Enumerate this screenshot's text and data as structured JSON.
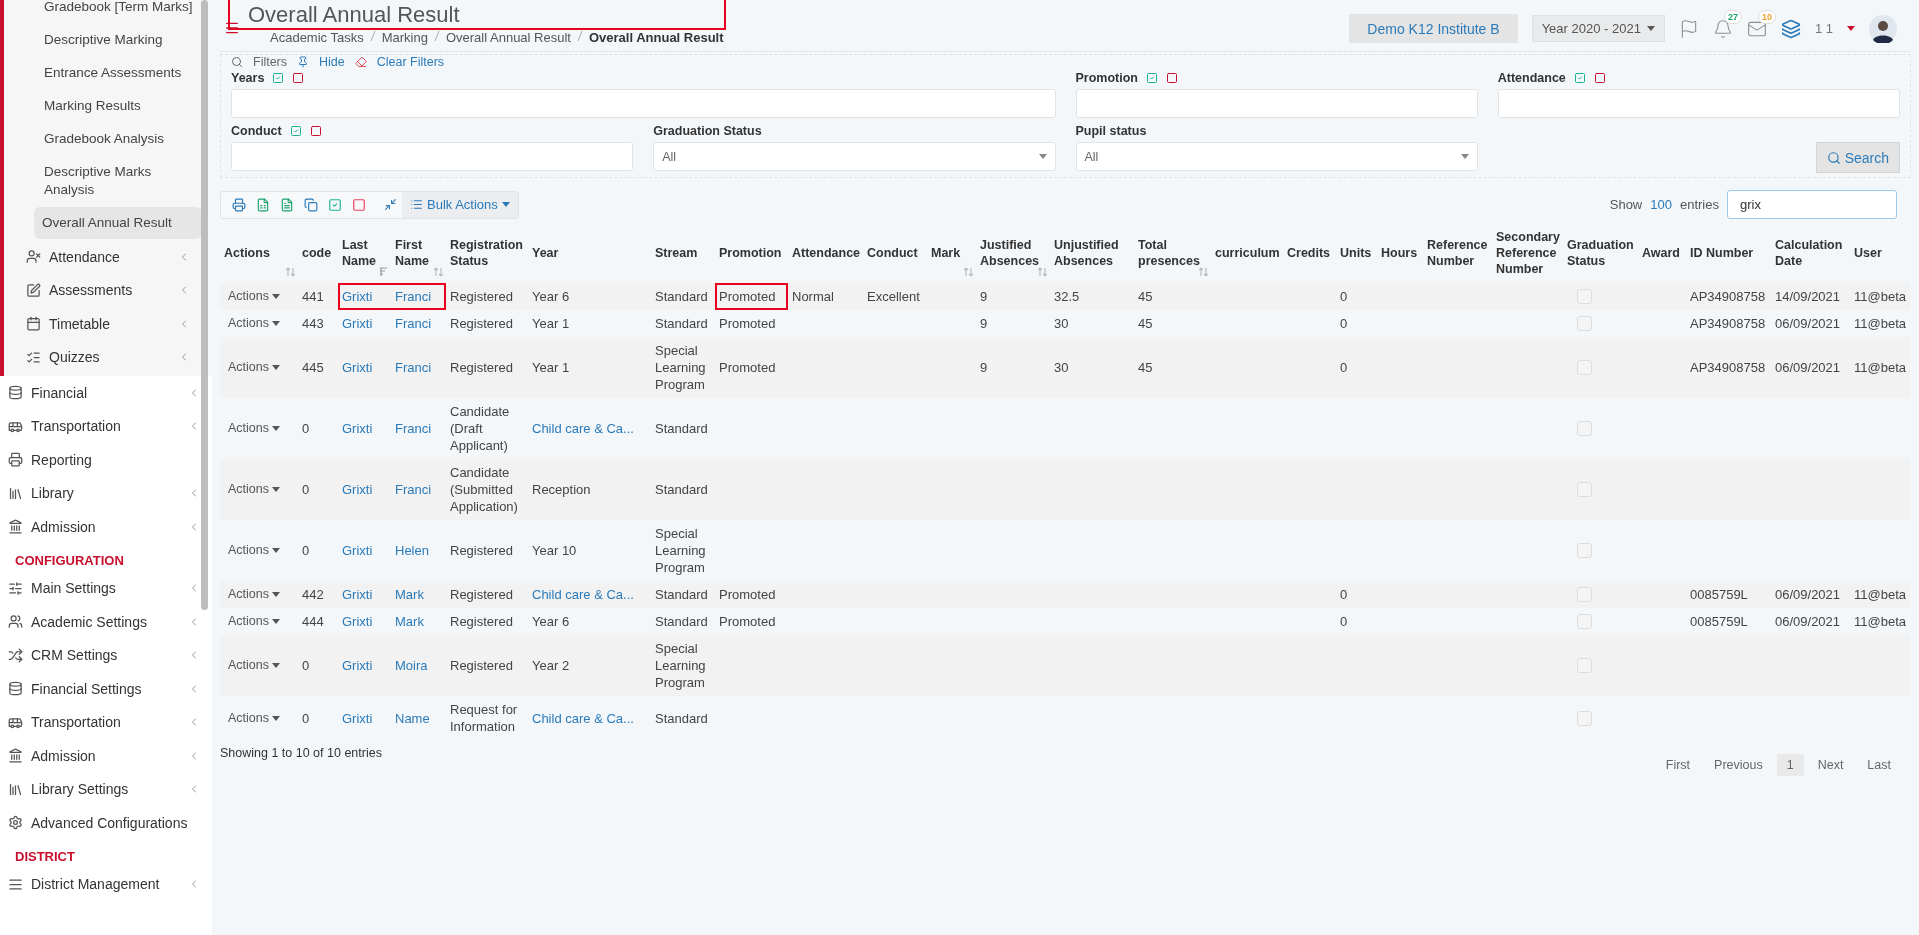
{
  "sidebar": {
    "submenu": [
      {
        "label": "Gradebook [Term Marks]",
        "selected": false
      },
      {
        "label": "Descriptive Marking",
        "selected": false
      },
      {
        "label": "Entrance Assessments",
        "selected": false
      },
      {
        "label": "Marking Results",
        "selected": false
      },
      {
        "label": "Gradebook Analysis",
        "selected": false
      },
      {
        "label": "Descriptive Marks Analysis",
        "selected": false
      },
      {
        "label": "Overall Annual Result",
        "selected": true
      }
    ],
    "modules": [
      {
        "label": "Attendance",
        "expandable": true
      },
      {
        "label": "Assessments",
        "expandable": true
      },
      {
        "label": "Timetable",
        "expandable": true
      },
      {
        "label": "Quizzes",
        "expandable": true
      }
    ],
    "items": [
      {
        "label": "Financial",
        "expandable": true
      },
      {
        "label": "Transportation",
        "expandable": true
      },
      {
        "label": "Reporting",
        "expandable": false
      },
      {
        "label": "Library",
        "expandable": true
      },
      {
        "label": "Admission",
        "expandable": true
      }
    ],
    "sections": [
      {
        "heading": "CONFIGURATION",
        "items": [
          {
            "label": "Main Settings",
            "expandable": true
          },
          {
            "label": "Academic Settings",
            "expandable": true
          },
          {
            "label": "CRM Settings",
            "expandable": true
          },
          {
            "label": "Financial Settings",
            "expandable": true
          },
          {
            "label": "Transportation",
            "expandable": true
          },
          {
            "label": "Admission",
            "expandable": true
          },
          {
            "label": "Library Settings",
            "expandable": true
          },
          {
            "label": "Advanced Configurations",
            "expandable": false
          }
        ]
      },
      {
        "heading": "DISTRICT",
        "items": [
          {
            "label": "District Management",
            "expandable": true
          }
        ]
      }
    ]
  },
  "header": {
    "title": "Overall Annual Result",
    "title_marked": true,
    "breadcrumb": [
      "Academic Tasks",
      "Marking",
      "Overall Annual Result",
      "Overall Annual Result"
    ],
    "institute": "Demo K12 Institute B",
    "year": "Year 2020 - 2021",
    "notifications_badge": "27",
    "messages_badge": "10",
    "user": "1 1"
  },
  "filters": {
    "title": "Filters",
    "hide": "Hide",
    "clear": "Clear Filters",
    "fields": [
      {
        "label": "Years",
        "kind": "multi"
      },
      {
        "label": "Promotion",
        "kind": "multi"
      },
      {
        "label": "Attendance",
        "kind": "multi"
      },
      {
        "label": "Conduct",
        "kind": "multi"
      },
      {
        "label": "Graduation Status",
        "kind": "select",
        "value": "All"
      },
      {
        "label": "Pupil status",
        "kind": "select",
        "value": "All"
      }
    ],
    "search_button": "Search"
  },
  "toolbar": {
    "bulk_actions": "Bulk Actions",
    "show": "Show",
    "entries_count": "100",
    "entries": "entries",
    "search_value": "grix"
  },
  "table": {
    "columns": [
      {
        "label": "Actions",
        "kind": "actions",
        "sortable": true,
        "sorted": false
      },
      {
        "label": "code",
        "kind": "text",
        "sortable": false
      },
      {
        "label": "Last Name",
        "kind": "link",
        "sortable": true,
        "sorted": true
      },
      {
        "label": "First Name",
        "kind": "link",
        "sortable": true,
        "sorted": false
      },
      {
        "label": "Registration Status",
        "kind": "text",
        "sortable": false
      },
      {
        "label": "Year",
        "kind": "text",
        "sortable": false
      },
      {
        "label": "Stream",
        "kind": "text",
        "sortable": false
      },
      {
        "label": "Promotion",
        "kind": "text",
        "sortable": false
      },
      {
        "label": "Attendance",
        "kind": "text",
        "sortable": false
      },
      {
        "label": "Conduct",
        "kind": "text",
        "sortable": false
      },
      {
        "label": "Mark",
        "kind": "text",
        "sortable": true,
        "sorted": false
      },
      {
        "label": "Justified Absences",
        "kind": "text",
        "sortable": true,
        "sorted": false
      },
      {
        "label": "Unjustified Absences",
        "kind": "text",
        "sortable": false
      },
      {
        "label": "Total presences",
        "kind": "text",
        "sortable": true,
        "sorted": false
      },
      {
        "label": "curriculum",
        "kind": "text",
        "sortable": false
      },
      {
        "label": "Credits",
        "kind": "text",
        "sortable": false
      },
      {
        "label": "Units",
        "kind": "text",
        "sortable": false
      },
      {
        "label": "Hours",
        "kind": "text",
        "sortable": false
      },
      {
        "label": "Reference Number",
        "kind": "text",
        "sortable": false
      },
      {
        "label": "Secondary Reference Number",
        "kind": "text",
        "sortable": false
      },
      {
        "label": "Graduation Status",
        "kind": "checkbox",
        "sortable": false
      },
      {
        "label": "Award",
        "kind": "text",
        "sortable": false
      },
      {
        "label": "ID Number",
        "kind": "text",
        "sortable": false
      },
      {
        "label": "Calculation Date",
        "kind": "text",
        "sortable": false
      },
      {
        "label": "User",
        "kind": "text",
        "sortable": false
      }
    ],
    "rows": [
      {
        "names_marked": true,
        "promotion_marked": true,
        "cells": [
          "Actions",
          "441",
          "Grixti",
          "Franci",
          "Registered",
          {
            "text": "Year 6",
            "link": false
          },
          "Standard",
          "Promoted",
          "Normal",
          "Excellent",
          null,
          "9",
          "32.5",
          "45",
          null,
          null,
          "0",
          null,
          null,
          null,
          false,
          null,
          "AP34908758",
          "14/09/2021",
          "11@beta"
        ]
      },
      {
        "names_marked": false,
        "promotion_marked": false,
        "cells": [
          "Actions",
          "443",
          "Grixti",
          "Franci",
          "Registered",
          {
            "text": "Year 1",
            "link": false
          },
          "Standard",
          "Promoted",
          null,
          null,
          null,
          "9",
          "30",
          "45",
          null,
          null,
          "0",
          null,
          null,
          null,
          false,
          null,
          "AP34908758",
          "06/09/2021",
          "11@beta"
        ]
      },
      {
        "names_marked": false,
        "promotion_marked": false,
        "cells": [
          "Actions",
          "445",
          "Grixti",
          "Franci",
          "Registered",
          {
            "text": "Year 1",
            "link": false
          },
          "Special Learning Program",
          "Promoted",
          null,
          null,
          null,
          "9",
          "30",
          "45",
          null,
          null,
          "0",
          null,
          null,
          null,
          false,
          null,
          "AP34908758",
          "06/09/2021",
          "11@beta"
        ]
      },
      {
        "names_marked": false,
        "promotion_marked": false,
        "cells": [
          "Actions",
          "0",
          "Grixti",
          "Franci",
          "Candidate (Draft Applicant)",
          {
            "text": "Child care & Ca...",
            "link": true
          },
          "Standard",
          null,
          null,
          null,
          null,
          null,
          null,
          null,
          null,
          null,
          null,
          null,
          null,
          null,
          false,
          null,
          null,
          null,
          null
        ]
      },
      {
        "names_marked": false,
        "promotion_marked": false,
        "cells": [
          "Actions",
          "0",
          "Grixti",
          "Franci",
          "Candidate (Submitted Application)",
          {
            "text": "Reception",
            "link": false
          },
          "Standard",
          null,
          null,
          null,
          null,
          null,
          null,
          null,
          null,
          null,
          null,
          null,
          null,
          null,
          false,
          null,
          null,
          null,
          null
        ]
      },
      {
        "names_marked": false,
        "promotion_marked": false,
        "cells": [
          "Actions",
          "0",
          "Grixti",
          "Helen",
          "Registered",
          {
            "text": "Year 10",
            "link": false
          },
          "Special Learning Program",
          null,
          null,
          null,
          null,
          null,
          null,
          null,
          null,
          null,
          null,
          null,
          null,
          null,
          false,
          null,
          null,
          null,
          null
        ]
      },
      {
        "names_marked": false,
        "promotion_marked": false,
        "cells": [
          "Actions",
          "442",
          "Grixti",
          "Mark",
          "Registered",
          {
            "text": "Child care & Ca...",
            "link": true
          },
          "Standard",
          "Promoted",
          null,
          null,
          null,
          null,
          null,
          null,
          null,
          null,
          "0",
          null,
          null,
          null,
          false,
          null,
          "0085759L",
          "06/09/2021",
          "11@beta"
        ]
      },
      {
        "names_marked": false,
        "promotion_marked": false,
        "cells": [
          "Actions",
          "444",
          "Grixti",
          "Mark",
          "Registered",
          {
            "text": "Year 6",
            "link": false
          },
          "Standard",
          "Promoted",
          null,
          null,
          null,
          null,
          null,
          null,
          null,
          null,
          "0",
          null,
          null,
          null,
          false,
          null,
          "0085759L",
          "06/09/2021",
          "11@beta"
        ]
      },
      {
        "names_marked": false,
        "promotion_marked": false,
        "cells": [
          "Actions",
          "0",
          "Grixti",
          "Moira",
          "Registered",
          {
            "text": "Year 2",
            "link": false
          },
          "Special Learning Program",
          null,
          null,
          null,
          null,
          null,
          null,
          null,
          null,
          null,
          null,
          null,
          null,
          null,
          false,
          null,
          null,
          null,
          null
        ]
      },
      {
        "names_marked": false,
        "promotion_marked": false,
        "cells": [
          "Actions",
          "0",
          "Grixti",
          "Name",
          "Request for Information",
          {
            "text": "Child care & Ca...",
            "link": true
          },
          "Standard",
          null,
          null,
          null,
          null,
          null,
          null,
          null,
          null,
          null,
          null,
          null,
          null,
          null,
          false,
          null,
          null,
          null,
          null
        ]
      }
    ]
  },
  "footer": {
    "info": "Showing 1 to 10 of 10 entries",
    "pages": [
      {
        "label": "First",
        "selected": false
      },
      {
        "label": "Previous",
        "selected": false
      },
      {
        "label": "1",
        "selected": true
      },
      {
        "label": "Next",
        "selected": false
      },
      {
        "label": "Last",
        "selected": false
      }
    ]
  }
}
